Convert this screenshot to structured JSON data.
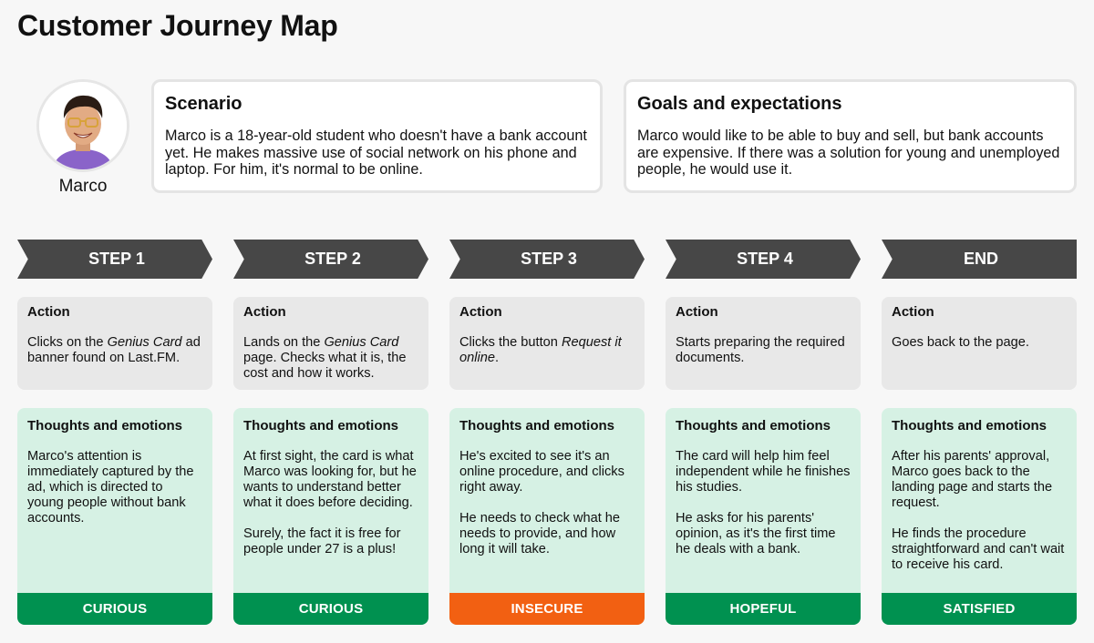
{
  "title": "Customer Journey Map",
  "persona": {
    "name": "Marco",
    "avatar_icon": "person-portrait-icon"
  },
  "scenario": {
    "title": "Scenario",
    "text": "Marco is a 18-year-old student who doesn't have a bank account yet. He makes massive use of social network on his phone and laptop. For him, it's normal to be online."
  },
  "goals": {
    "title": "Goals and expectations",
    "text": "Marco would like to be able to buy and sell, but bank accounts are expensive. If there was a solution for young and unemployed people, he would use it."
  },
  "labels": {
    "action": "Action",
    "thoughts": "Thoughts and emotions"
  },
  "colors": {
    "step_bar": "#474747",
    "action_bg": "#e8e8e8",
    "thoughts_bg": "#d6f1e4",
    "positive": "#009150",
    "negative": "#f26012"
  },
  "steps": [
    {
      "label": "STEP 1",
      "action": [
        "Clicks on the ",
        {
          "i": "Genius Card"
        },
        " ad banner found on Last.FM."
      ],
      "thoughts": [
        "Marco's attention is immediately captured by the ad, which is directed to young people without bank accounts."
      ],
      "emotion": "CURIOUS",
      "emotion_color": "#009150"
    },
    {
      "label": "STEP 2",
      "action": [
        "Lands on the ",
        {
          "i": "Genius Card"
        },
        " page. Checks what it is, the cost and how it works."
      ],
      "thoughts": [
        "At first sight, the card is what Marco was looking for, but he wants to understand better what it does before deciding.",
        "Surely, the fact it is free for people under 27 is a plus!"
      ],
      "emotion": "CURIOUS",
      "emotion_color": "#009150"
    },
    {
      "label": "STEP 3",
      "action": [
        "Clicks the button ",
        {
          "i": "Request it online"
        },
        "."
      ],
      "thoughts": [
        "He's excited to see it's an online procedure, and clicks right away.",
        "He needs to check what he needs to provide, and how long it will take."
      ],
      "emotion": "INSECURE",
      "emotion_color": "#f26012"
    },
    {
      "label": "STEP 4",
      "action": [
        "Starts preparing the required documents."
      ],
      "thoughts": [
        "The card will help him feel independent while he finishes his studies.",
        "He asks for his parents' opinion, as it's the first time he deals with a bank."
      ],
      "emotion": "HOPEFUL",
      "emotion_color": "#009150"
    },
    {
      "label": "END",
      "action": [
        "Goes back to the page."
      ],
      "thoughts": [
        "After his parents' approval, Marco goes back to the landing page and starts the request.",
        "He finds the procedure straightforward and can't wait to receive his card."
      ],
      "emotion": "SATISFIED",
      "emotion_color": "#009150"
    }
  ]
}
